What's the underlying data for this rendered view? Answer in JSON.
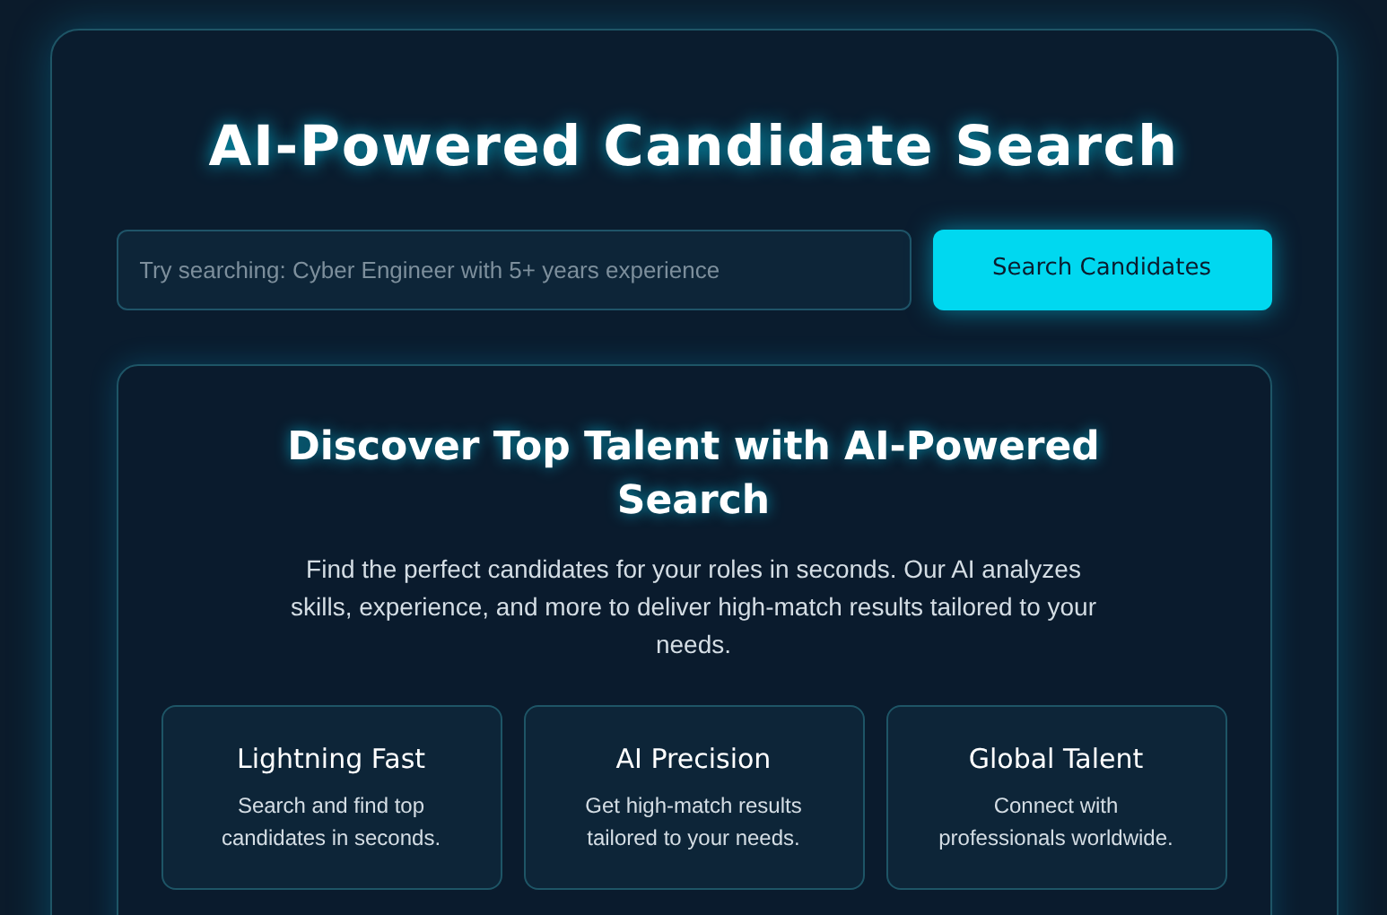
{
  "title": "AI-Powered Candidate Search",
  "search": {
    "placeholder": "Try searching: Cyber Engineer with 5+ years experience",
    "button": "Search Candidates"
  },
  "intro": {
    "heading": "Discover Top Talent with AI-Powered Search",
    "text": "Find the perfect candidates for your roles in seconds. Our AI analyzes skills, experience, and more to deliver high-match results tailored to your needs."
  },
  "features": [
    {
      "title": "Lightning Fast",
      "text": "Search and find top candidates in seconds."
    },
    {
      "title": "AI Precision",
      "text": "Get high-match results tailored to your needs."
    },
    {
      "title": "Global Talent",
      "text": "Connect with professionals worldwide."
    }
  ]
}
